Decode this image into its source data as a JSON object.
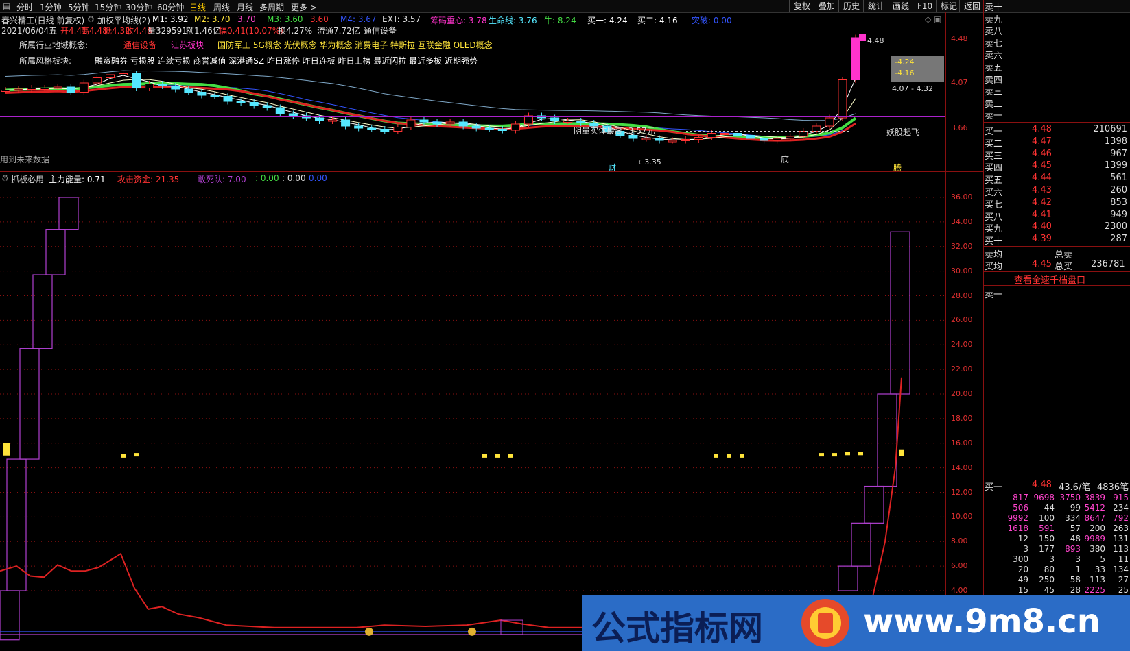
{
  "toolbar": {
    "period_tabs": [
      "分时",
      "1分钟",
      "5分钟",
      "15分钟",
      "30分钟",
      "60分钟",
      "日线",
      "周线",
      "月线",
      "多周期",
      "更多 >"
    ],
    "active_tab": "日线",
    "right_buttons": [
      "复权",
      "叠加",
      "历史",
      "统计",
      "画线",
      "F10",
      "标记",
      "返回"
    ]
  },
  "chart_header": {
    "stock_title": "春兴精工(日线 前复权)",
    "indicator_name": "加权平均线(2)",
    "m1": "M1: 3.92",
    "m2": "M2: 3.70",
    "m2b": "3.70",
    "m3": "M3: 3.60",
    "m3b": "3.60",
    "m4": "M4: 3.67",
    "ext": "EXT: 3.57",
    "chip_center": "筹码重心: 3.78",
    "life_line": "生命线: 3.76",
    "niu": "牛: 8.24",
    "buy1": "买一: 4.24",
    "buy2": "买二: 4.16",
    "breakout": "突破: 0.00",
    "date": "2021/06/04五",
    "open": "开4.41",
    "high": "高4.48",
    "low": "低4.32",
    "close": "收4.48",
    "volume": "量329591",
    "amount": "额1.46亿",
    "change": "幅0.41(10.07%)",
    "turnover": "换4.27%",
    "float_cap": "流通7.72亿",
    "sector": "通信设备"
  },
  "concepts": {
    "industry_label": "所属行业地域概念:",
    "industry": "通信设备",
    "region": "江苏板块",
    "concept_list": "国防军工 5G概念 光伏概念 华为概念 消费电子 特斯拉 互联金融 OLED概念",
    "style_label": "所属风格板块:",
    "style_list": "融资融券 亏损股 连续亏损 商誉减值 深港通SZ 昨日涨停 昨日连板 昨日上榜 最近闪拉 最近多板 近期强势"
  },
  "annotations": {
    "high_price": "4.48",
    "low_price": "←3.35",
    "yin_body_high": "阴量实体最高: 3.57元",
    "demon_takeoff": "妖股起飞",
    "range_label": "4.07 - 4.32",
    "tip1": "-4.24",
    "tip2": "-4.16",
    "mark_cai": "财",
    "mark_di": "底",
    "mark_teng": "腾",
    "future_data_warning": "用到未来数据"
  },
  "chart_data": [
    {
      "type": "candlestick",
      "title": "春兴精工(日线 前复权)",
      "y_axis_ticks": [
        3.66,
        4.07,
        4.48
      ],
      "series": [
        {
          "name": "M1",
          "last": 3.92
        },
        {
          "name": "M2",
          "last": 3.7
        },
        {
          "name": "M3",
          "last": 3.6
        },
        {
          "name": "M4",
          "last": 3.67
        }
      ],
      "close": [
        3.97,
        3.98,
        3.99,
        3.99,
        4.0,
        3.95,
        4.04,
        4.09,
        4.12,
        4.13,
        3.99,
        4.03,
        4.01,
        3.98,
        3.95,
        3.92,
        3.91,
        3.86,
        3.85,
        3.82,
        3.8,
        3.74,
        3.72,
        3.7,
        3.67,
        3.68,
        3.62,
        3.6,
        3.59,
        3.57,
        3.61,
        3.68,
        3.66,
        3.64,
        3.66,
        3.62,
        3.6,
        3.59,
        3.58,
        3.64,
        3.72,
        3.7,
        3.67,
        3.67,
        3.65,
        3.62,
        3.57,
        3.53,
        3.5,
        3.5,
        3.48,
        3.48,
        3.49,
        3.51,
        3.55,
        3.55,
        3.53,
        3.5,
        3.48,
        3.5,
        3.52,
        3.57,
        3.62,
        3.7,
        4.07,
        4.48
      ],
      "last": {
        "open": 4.41,
        "high": 4.48,
        "low": 4.32,
        "close": 4.48
      }
    },
    {
      "type": "bar",
      "title": "抓板必用",
      "ylim": [
        4,
        36
      ],
      "y_axis_ticks": [
        4.0,
        6.0,
        8.0,
        10.0,
        12.0,
        14.0,
        16.0,
        18.0,
        20.0,
        22.0,
        24.0,
        26.0,
        28.0,
        30.0,
        32.0,
        34.0,
        36.0
      ],
      "series": [
        {
          "name": "主力能量",
          "last": 0.71
        },
        {
          "name": "攻击资金",
          "last": 21.35
        },
        {
          "name": "敢死队",
          "last": 7.0
        },
        {
          "name": "",
          "last": 0.0
        },
        {
          "name": "",
          "last": 0.0
        },
        {
          "name": "",
          "last": 0.0
        }
      ],
      "ladder_left": [
        [
          0,
          4
        ],
        [
          4,
          14.7
        ],
        [
          14.7,
          23.7
        ],
        [
          23.7,
          29.7
        ],
        [
          29.7,
          33.4
        ],
        [
          33.4,
          36
        ]
      ],
      "ladder_right": [
        [
          4,
          6
        ],
        [
          6,
          9.5
        ],
        [
          9.5,
          12.5
        ],
        [
          12.5,
          20
        ],
        [
          20,
          33.2
        ]
      ]
    }
  ],
  "lower_header": {
    "title": "抓板必用",
    "main_energy": "主力能量: 0.71",
    "attack_fund": "攻击资金: 21.35",
    "dare_team": "敢死队: 7.00",
    "v1": ": 0.00",
    "v2": ": 0.00",
    "v3": "0.00"
  },
  "right_panel": {
    "sell_labels": [
      "卖十",
      "卖九",
      "卖八",
      "卖七",
      "卖六",
      "卖五",
      "卖四",
      "卖三",
      "卖二",
      "卖一"
    ],
    "buy_levels": [
      {
        "label": "买一",
        "price": "4.48",
        "vol": "210691"
      },
      {
        "label": "买二",
        "price": "4.47",
        "vol": "1398"
      },
      {
        "label": "买三",
        "price": "4.46",
        "vol": "967"
      },
      {
        "label": "买四",
        "price": "4.45",
        "vol": "1399"
      },
      {
        "label": "买五",
        "price": "4.44",
        "vol": "561"
      },
      {
        "label": "买六",
        "price": "4.43",
        "vol": "260"
      },
      {
        "label": "买七",
        "price": "4.42",
        "vol": "853"
      },
      {
        "label": "买八",
        "price": "4.41",
        "vol": "949"
      },
      {
        "label": "买九",
        "price": "4.40",
        "vol": "2300"
      },
      {
        "label": "买十",
        "price": "4.39",
        "vol": "287"
      }
    ],
    "sell_avg_label": "卖均",
    "total_sell_label": "总卖",
    "buy_avg_label": "买均",
    "buy_avg": "4.45",
    "total_buy_label": "总买",
    "total_buy": "236781",
    "full_depth_link": "查看全速千档盘口",
    "sell1_queue_label": "卖一",
    "buy1_queue": {
      "label": "买一",
      "price": "4.48",
      "avg": "43.6/笔",
      "count": "4836笔"
    },
    "queue_rows": [
      [
        "817",
        "9698",
        "3750",
        "3839",
        "915"
      ],
      [
        "506",
        "44",
        "99",
        "5412",
        "234"
      ],
      [
        "9992",
        "100",
        "334",
        "8647",
        "792"
      ],
      [
        "1618",
        "591",
        "57",
        "200",
        "263"
      ],
      [
        "12",
        "150",
        "48",
        "9989",
        "131"
      ],
      [
        "3",
        "177",
        "893",
        "380",
        "113"
      ],
      [
        "300",
        "3",
        "3",
        "5",
        "11"
      ],
      [
        "20",
        "80",
        "1",
        "33",
        "134"
      ],
      [
        "49",
        "250",
        "58",
        "113",
        "27"
      ],
      [
        "15",
        "45",
        "28",
        "2225",
        "25"
      ]
    ]
  },
  "watermark": {
    "cn": "公式指标网",
    "url": "www.9m8.cn"
  },
  "colors": {
    "up": "#ff3333",
    "down": "#55e8ff",
    "grid": "#8a1010",
    "green_line": "#44dd44",
    "red_line": "#dd2222",
    "white_line": "#ffffff",
    "yellow": "#ffe43a",
    "magenta": "#ff33cc",
    "purple_box": "#b040d0"
  }
}
